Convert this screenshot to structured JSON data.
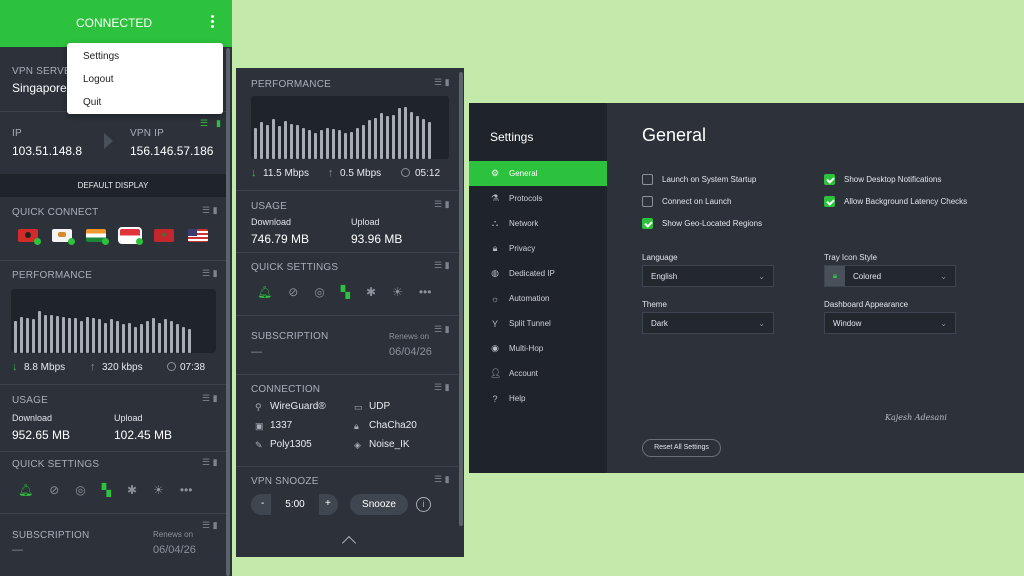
{
  "left": {
    "header_status": "CONNECTED",
    "menu": [
      "Settings",
      "Logout",
      "Quit"
    ],
    "vpn_server_label": "VPN SERVER",
    "vpn_server_value": "Singapore",
    "ip_label": "IP",
    "ip_value": "103.51.148.8",
    "vpn_ip_label": "VPN IP",
    "vpn_ip_value": "156.146.57.186",
    "default_display": "DEFAULT DISPLAY",
    "quick_connect": "QUICK CONNECT",
    "performance": "PERFORMANCE",
    "download_speed": "8.8 Mbps",
    "upload_speed": "320 kbps",
    "time": "07:38",
    "usage": "USAGE",
    "download_label": "Download",
    "download_value": "952.65 MB",
    "upload_label": "Upload",
    "upload_value": "102.45 MB",
    "quick_settings": "QUICK SETTINGS",
    "subscription": "SUBSCRIPTION",
    "renews_on": "Renews on",
    "renew_date": "06/04/26",
    "dash": "—"
  },
  "middle": {
    "performance": "PERFORMANCE",
    "download_speed": "11.5 Mbps",
    "upload_speed": "0.5 Mbps",
    "time": "05:12",
    "usage": "USAGE",
    "download_label": "Download",
    "download_value": "746.79 MB",
    "upload_label": "Upload",
    "upload_value": "93.96 MB",
    "quick_settings": "QUICK SETTINGS",
    "subscription": "SUBSCRIPTION",
    "renews_on": "Renews on",
    "renew_date": "06/04/26",
    "dash": "—",
    "connection": "CONNECTION",
    "protocol": "WireGuard®",
    "transport": "UDP",
    "port": "1337",
    "cipher": "ChaCha20",
    "auth": "Poly1305",
    "handshake": "Noise_IK",
    "vpn_snooze": "VPN SNOOZE",
    "snooze_minus": "-",
    "snooze_time": "5:00",
    "snooze_plus": "+",
    "snooze_button": "Snooze"
  },
  "settings": {
    "title": "Settings",
    "nav": [
      "General",
      "Protocols",
      "Network",
      "Privacy",
      "Dedicated IP",
      "Automation",
      "Split Tunnel",
      "Multi-Hop",
      "Account",
      "Help"
    ],
    "heading": "General",
    "opt_startup": "Launch on System Startup",
    "opt_connect_launch": "Connect on Launch",
    "opt_geo": "Show Geo-Located Regions",
    "opt_notifications": "Show Desktop Notifications",
    "opt_latency": "Allow Background Latency Checks",
    "language_label": "Language",
    "language_value": "English",
    "tray_label": "Tray Icon Style",
    "tray_value": "Colored",
    "theme_label": "Theme",
    "theme_value": "Dark",
    "dashboard_label": "Dashboard Appearance",
    "dashboard_value": "Window",
    "signature": "Kajesh Adesani",
    "reset_button": "Reset All Settings"
  },
  "perf_left": [
    0.55,
    0.62,
    0.6,
    0.58,
    0.72,
    0.65,
    0.66,
    0.64,
    0.62,
    0.6,
    0.6,
    0.55,
    0.62,
    0.6,
    0.58,
    0.52,
    0.58,
    0.55,
    0.5,
    0.52,
    0.45,
    0.5,
    0.55,
    0.6,
    0.52,
    0.58,
    0.55,
    0.5,
    0.45,
    0.42
  ],
  "perf_middle": [
    0.55,
    0.65,
    0.6,
    0.7,
    0.58,
    0.66,
    0.62,
    0.6,
    0.55,
    0.5,
    0.45,
    0.5,
    0.55,
    0.52,
    0.5,
    0.45,
    0.48,
    0.55,
    0.6,
    0.68,
    0.72,
    0.8,
    0.75,
    0.78,
    0.9,
    0.92,
    0.82,
    0.76,
    0.7,
    0.65
  ]
}
